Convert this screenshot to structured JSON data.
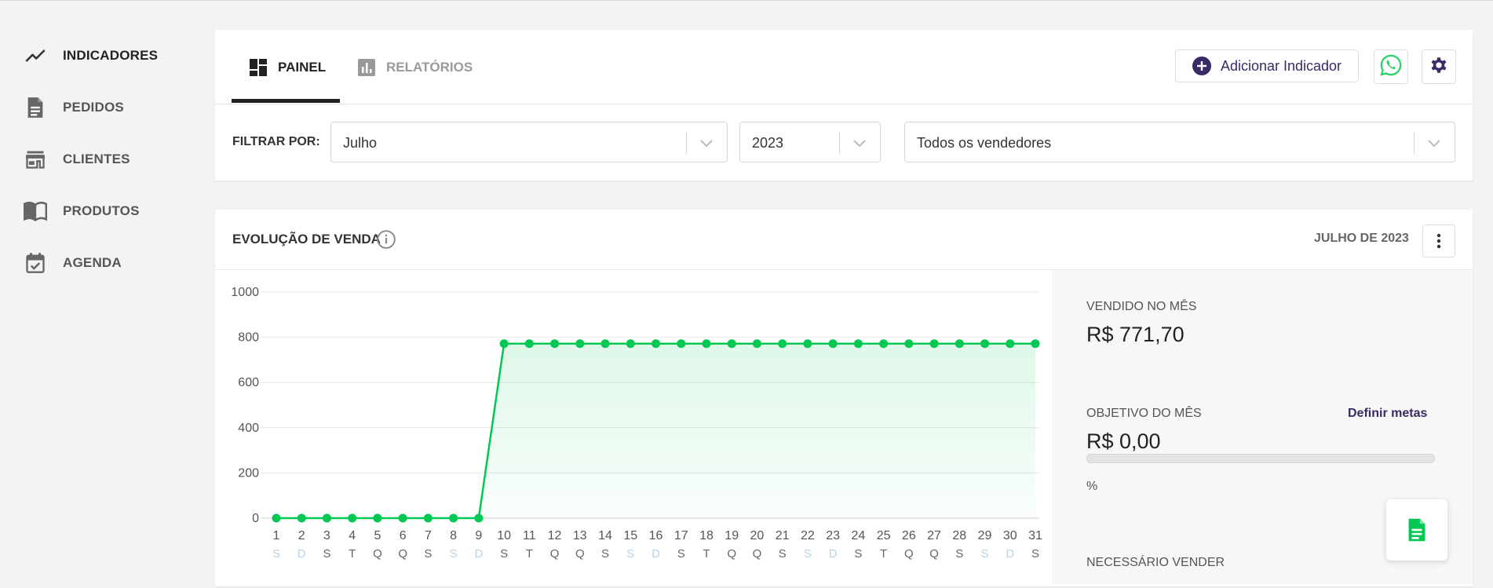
{
  "sidebar": {
    "items": [
      {
        "label": "INDICADORES",
        "icon": "trending-up-icon",
        "active": true
      },
      {
        "label": "PEDIDOS",
        "icon": "document-icon",
        "active": false
      },
      {
        "label": "CLIENTES",
        "icon": "store-icon",
        "active": false
      },
      {
        "label": "PRODUTOS",
        "icon": "book-icon",
        "active": false
      },
      {
        "label": "AGENDA",
        "icon": "calendar-check-icon",
        "active": false
      }
    ]
  },
  "header": {
    "tabs": [
      {
        "label": "PAINEL",
        "icon": "dashboard-icon",
        "active": true
      },
      {
        "label": "RELATÓRIOS",
        "icon": "bar-chart-icon",
        "active": false
      }
    ],
    "add_button_label": "Adicionar Indicador",
    "whatsapp_icon": "whatsapp-icon",
    "settings_icon": "gear-icon"
  },
  "filters": {
    "label": "FILTRAR POR:",
    "month": "Julho",
    "year": "2023",
    "sellers": "Todos os vendedores"
  },
  "colors": {
    "accent": "#3a2a66",
    "green": "#00c853",
    "whatsapp": "#25d366"
  },
  "sales_card": {
    "title": "EVOLUÇÃO DE VENDA",
    "period": "JULHO DE 2023",
    "sold_label": "VENDIDO NO MÊS",
    "sold_value": "R$ 771,70",
    "goal_label": "OBJETIVO DO MÊS",
    "goal_link": "Definir metas",
    "goal_value": "R$ 0,00",
    "goal_progress": 0,
    "percent_text": "%",
    "needed_label": "NECESSÁRIO VENDER"
  },
  "chart_data": {
    "type": "area",
    "title": "EVOLUÇÃO DE VENDA",
    "x": [
      1,
      2,
      3,
      4,
      5,
      6,
      7,
      8,
      9,
      10,
      11,
      12,
      13,
      14,
      15,
      16,
      17,
      18,
      19,
      20,
      21,
      22,
      23,
      24,
      25,
      26,
      27,
      28,
      29,
      30,
      31
    ],
    "weekday_labels": [
      "S",
      "D",
      "S",
      "T",
      "Q",
      "Q",
      "S",
      "S",
      "D",
      "S",
      "T",
      "Q",
      "Q",
      "S",
      "S",
      "D",
      "S",
      "T",
      "Q",
      "Q",
      "S",
      "S",
      "D",
      "S",
      "T",
      "Q",
      "Q",
      "S",
      "S",
      "D",
      "S"
    ],
    "weekend_days": [
      1,
      2,
      8,
      9,
      15,
      16,
      22,
      23,
      29,
      30
    ],
    "series": [
      {
        "values": [
          0,
          0,
          0,
          0,
          0,
          0,
          0,
          0,
          0,
          771.7,
          771.7,
          771.7,
          771.7,
          771.7,
          771.7,
          771.7,
          771.7,
          771.7,
          771.7,
          771.7,
          771.7,
          771.7,
          771.7,
          771.7,
          771.7,
          771.7,
          771.7,
          771.7,
          771.7,
          771.7,
          771.7
        ]
      }
    ],
    "yticks": [
      0,
      200,
      400,
      600,
      800,
      1000
    ],
    "ylim": [
      0,
      1000
    ],
    "grid": true,
    "color": "#00c853"
  }
}
